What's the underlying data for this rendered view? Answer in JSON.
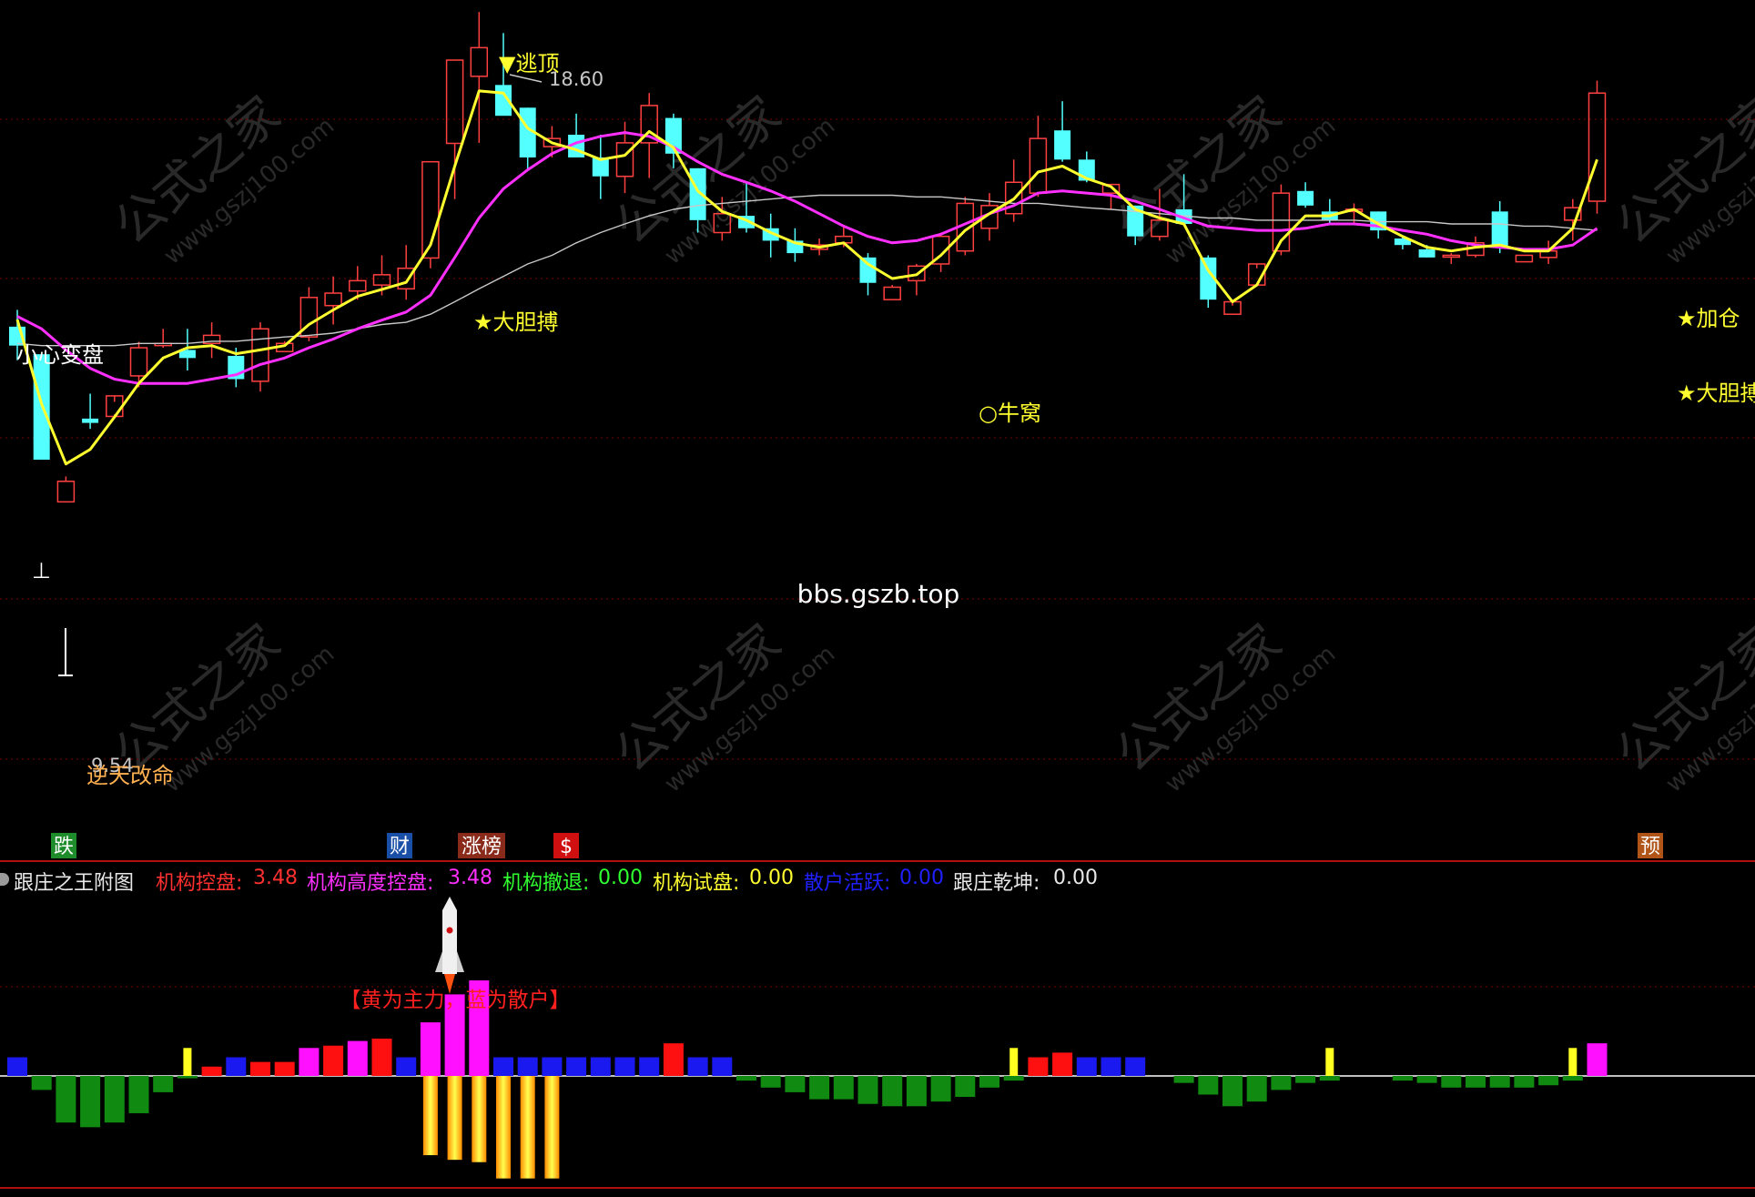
{
  "watermarks": {
    "site": "bbs.gszb.top",
    "brand": "公式之家",
    "brand_url": "www.gszj100.com"
  },
  "main_chart": {
    "annotations": {
      "escape_top": "逃顶",
      "high_value": "18.60",
      "bold_1": "大胆搏",
      "careful": "小心变盘",
      "bull_nest": "牛窝",
      "add_pos": "加仓",
      "bold_2": "大胆搏",
      "low_value": "9.54",
      "reverse": "逆天改命"
    },
    "event_badges": [
      {
        "text": "跌",
        "color": "#1e8c2a"
      },
      {
        "text": "财",
        "color": "#1a4fa8"
      },
      {
        "text": "涨榜",
        "color": "#8a2a1a"
      },
      {
        "text": "$",
        "color": "#d01010"
      },
      {
        "text": "预",
        "color": "#b05418"
      }
    ],
    "colors": {
      "up": "#ff4040",
      "down": "#54ffff",
      "ma_fast": "#ffff30",
      "ma_mid": "#ff30ff",
      "ma_slow": "#c8c8c8",
      "grid": "#7a0000"
    }
  },
  "info_bar": {
    "indicator_name": "跟庄之王附图",
    "items": [
      {
        "label": "机构控盘: ",
        "value": "3.48",
        "color": "#ff3030"
      },
      {
        "label": "机构高度控盘: ",
        "value": "3.48",
        "color": "#ff30ff"
      },
      {
        "label": "机构撤退: ",
        "value": "0.00",
        "color": "#30ff30"
      },
      {
        "label": "机构试盘: ",
        "value": "0.00",
        "color": "#ffff30"
      },
      {
        "label": "散户活跃: ",
        "value": "0.00",
        "color": "#2020ff"
      },
      {
        "label": "跟庄乾坤: ",
        "value": "0.00",
        "color": "#e8e8e8"
      }
    ],
    "note": "【黄为主力，蓝为散户】"
  },
  "chart_data": [
    {
      "type": "candlestick",
      "title": "",
      "price_labels": {
        "high": 18.6,
        "low": 9.54
      },
      "candles": [
        {
          "o": 12.78,
          "h": 13.09,
          "l": 12.16,
          "c": 12.43
        },
        {
          "o": 12.27,
          "h": 12.27,
          "l": 10.32,
          "c": 10.32
        },
        {
          "o": 9.54,
          "h": 10.01,
          "l": 9.54,
          "c": 9.92
        },
        {
          "o": 11.08,
          "h": 11.54,
          "l": 10.89,
          "c": 11.0
        },
        {
          "o": 11.12,
          "h": 11.39,
          "l": 11.16,
          "c": 11.5
        },
        {
          "o": 11.87,
          "h": 12.5,
          "l": 11.66,
          "c": 12.39
        },
        {
          "o": 12.43,
          "h": 12.74,
          "l": 12.39,
          "c": 12.47
        },
        {
          "o": 12.35,
          "h": 12.74,
          "l": 11.97,
          "c": 12.2
        },
        {
          "o": 12.47,
          "h": 12.86,
          "l": 12.2,
          "c": 12.62
        },
        {
          "o": 12.24,
          "h": 12.39,
          "l": 11.66,
          "c": 11.81
        },
        {
          "o": 11.77,
          "h": 12.86,
          "l": 11.58,
          "c": 12.74
        },
        {
          "o": 12.32,
          "h": 12.51,
          "l": 12.32,
          "c": 12.47
        },
        {
          "o": 12.59,
          "h": 13.51,
          "l": 12.51,
          "c": 13.32
        },
        {
          "o": 13.17,
          "h": 13.71,
          "l": 12.82,
          "c": 13.4
        },
        {
          "o": 13.44,
          "h": 13.9,
          "l": 13.28,
          "c": 13.63
        },
        {
          "o": 13.55,
          "h": 14.1,
          "l": 13.36,
          "c": 13.74
        },
        {
          "o": 13.48,
          "h": 14.29,
          "l": 13.28,
          "c": 13.86
        },
        {
          "o": 14.05,
          "h": 15.83,
          "l": 13.86,
          "c": 15.83
        },
        {
          "o": 16.17,
          "h": 17.71,
          "l": 15.14,
          "c": 17.71
        },
        {
          "o": 17.41,
          "h": 18.6,
          "l": 16.18,
          "c": 17.94
        },
        {
          "o": 17.25,
          "h": 18.21,
          "l": 16.87,
          "c": 16.68
        },
        {
          "o": 16.83,
          "h": 16.83,
          "l": 15.68,
          "c": 15.91
        },
        {
          "o": 16.11,
          "h": 16.49,
          "l": 15.91,
          "c": 16.26
        },
        {
          "o": 16.33,
          "h": 16.72,
          "l": 16.1,
          "c": 15.91
        },
        {
          "o": 15.91,
          "h": 16.33,
          "l": 15.14,
          "c": 15.56
        },
        {
          "o": 15.56,
          "h": 16.57,
          "l": 15.25,
          "c": 16.18
        },
        {
          "o": 16.18,
          "h": 17.1,
          "l": 15.53,
          "c": 16.87
        },
        {
          "o": 16.64,
          "h": 16.72,
          "l": 15.71,
          "c": 15.98
        },
        {
          "o": 15.71,
          "h": 15.71,
          "l": 14.52,
          "c": 14.75
        },
        {
          "o": 14.52,
          "h": 15.18,
          "l": 14.37,
          "c": 14.87
        },
        {
          "o": 14.83,
          "h": 15.45,
          "l": 14.52,
          "c": 14.6
        },
        {
          "o": 14.6,
          "h": 14.87,
          "l": 14.06,
          "c": 14.37
        },
        {
          "o": 14.37,
          "h": 14.6,
          "l": 13.98,
          "c": 14.14
        },
        {
          "o": 14.21,
          "h": 14.41,
          "l": 14.1,
          "c": 14.29
        },
        {
          "o": 14.33,
          "h": 14.64,
          "l": 14.25,
          "c": 14.45
        },
        {
          "o": 14.06,
          "h": 14.14,
          "l": 13.36,
          "c": 13.59
        },
        {
          "o": 13.28,
          "h": 13.55,
          "l": 13.28,
          "c": 13.51
        },
        {
          "o": 13.63,
          "h": 13.94,
          "l": 13.36,
          "c": 13.9
        },
        {
          "o": 13.94,
          "h": 14.52,
          "l": 13.79,
          "c": 14.45
        },
        {
          "o": 14.18,
          "h": 15.18,
          "l": 14.1,
          "c": 15.06
        },
        {
          "o": 14.6,
          "h": 15.25,
          "l": 14.37,
          "c": 15.02
        },
        {
          "o": 14.87,
          "h": 15.87,
          "l": 14.72,
          "c": 15.45
        },
        {
          "o": 15.25,
          "h": 16.68,
          "l": 15.18,
          "c": 16.26
        },
        {
          "o": 16.41,
          "h": 16.95,
          "l": 15.83,
          "c": 15.87
        },
        {
          "o": 15.87,
          "h": 16.02,
          "l": 15.45,
          "c": 15.48
        },
        {
          "o": 15.25,
          "h": 15.41,
          "l": 14.95,
          "c": 15.41
        },
        {
          "o": 15.02,
          "h": 15.02,
          "l": 14.29,
          "c": 14.45
        },
        {
          "o": 14.45,
          "h": 15.33,
          "l": 14.37,
          "c": 14.75
        },
        {
          "o": 14.95,
          "h": 15.6,
          "l": 14.68,
          "c": 14.68
        },
        {
          "o": 14.06,
          "h": 14.1,
          "l": 13.13,
          "c": 13.28
        },
        {
          "o": 13.01,
          "h": 13.17,
          "l": 13.01,
          "c": 13.24
        },
        {
          "o": 13.55,
          "h": 13.86,
          "l": 13.55,
          "c": 13.94
        },
        {
          "o": 14.18,
          "h": 15.41,
          "l": 14.1,
          "c": 15.25
        },
        {
          "o": 15.29,
          "h": 15.45,
          "l": 14.98,
          "c": 15.02
        },
        {
          "o": 14.91,
          "h": 15.14,
          "l": 14.68,
          "c": 14.75
        },
        {
          "o": 14.91,
          "h": 15.06,
          "l": 14.68,
          "c": 14.95
        },
        {
          "o": 14.91,
          "h": 14.91,
          "l": 14.41,
          "c": 14.56
        },
        {
          "o": 14.41,
          "h": 14.45,
          "l": 14.21,
          "c": 14.29
        },
        {
          "o": 14.21,
          "h": 14.29,
          "l": 14.06,
          "c": 14.06
        },
        {
          "o": 14.1,
          "h": 14.14,
          "l": 13.94,
          "c": 14.1
        },
        {
          "o": 14.1,
          "h": 14.45,
          "l": 14.06,
          "c": 14.33
        },
        {
          "o": 14.91,
          "h": 15.1,
          "l": 14.14,
          "c": 14.25
        },
        {
          "o": 13.98,
          "h": 14.1,
          "l": 13.98,
          "c": 14.1
        },
        {
          "o": 14.06,
          "h": 14.37,
          "l": 13.94,
          "c": 14.18
        },
        {
          "o": 14.75,
          "h": 15.14,
          "l": 14.37,
          "c": 14.98
        },
        {
          "o": 15.1,
          "h": 17.33,
          "l": 14.87,
          "c": 17.1
        }
      ],
      "ma_fast": [
        12.91,
        11.35,
        10.24,
        10.51,
        11.11,
        11.73,
        12.2,
        12.39,
        12.43,
        12.28,
        12.35,
        12.43,
        12.82,
        13.09,
        13.34,
        13.47,
        13.6,
        14.29,
        15.75,
        17.14,
        17.1,
        16.45,
        16.18,
        16.05,
        15.87,
        15.95,
        16.39,
        16.09,
        15.29,
        14.91,
        14.75,
        14.52,
        14.33,
        14.25,
        14.33,
        13.94,
        13.67,
        13.74,
        14.1,
        14.56,
        14.87,
        15.14,
        15.64,
        15.75,
        15.52,
        15.37,
        14.95,
        14.79,
        14.68,
        13.82,
        13.24,
        13.55,
        14.37,
        14.83,
        14.83,
        14.95,
        14.68,
        14.45,
        14.25,
        14.18,
        14.25,
        14.29,
        14.18,
        14.18,
        14.6,
        15.87
      ],
      "ma_mid": [
        12.97,
        12.74,
        12.35,
        12.01,
        11.81,
        11.73,
        11.73,
        11.73,
        11.81,
        11.89,
        12.08,
        12.2,
        12.39,
        12.55,
        12.74,
        12.9,
        13.05,
        13.36,
        14.06,
        14.79,
        15.33,
        15.68,
        15.98,
        16.18,
        16.3,
        16.37,
        16.3,
        16.1,
        15.83,
        15.6,
        15.45,
        15.29,
        15.1,
        14.87,
        14.64,
        14.45,
        14.33,
        14.37,
        14.49,
        14.68,
        14.87,
        15.02,
        15.25,
        15.29,
        15.25,
        15.21,
        15.1,
        14.95,
        14.79,
        14.64,
        14.6,
        14.56,
        14.56,
        14.6,
        14.68,
        14.68,
        14.64,
        14.56,
        14.49,
        14.37,
        14.29,
        14.25,
        14.21,
        14.21,
        14.29,
        14.6
      ],
      "ma_slow": [
        12.47,
        12.43,
        12.43,
        12.43,
        12.43,
        12.47,
        12.47,
        12.47,
        12.51,
        12.51,
        12.55,
        12.59,
        12.62,
        12.66,
        12.74,
        12.82,
        12.86,
        13.01,
        13.24,
        13.48,
        13.71,
        13.94,
        14.1,
        14.33,
        14.52,
        14.68,
        14.83,
        14.95,
        15.02,
        15.06,
        15.1,
        15.14,
        15.18,
        15.21,
        15.21,
        15.21,
        15.21,
        15.18,
        15.18,
        15.14,
        15.1,
        15.06,
        15.06,
        15.02,
        14.98,
        14.95,
        14.91,
        14.87,
        14.83,
        14.79,
        14.79,
        14.75,
        14.75,
        14.75,
        14.75,
        14.75,
        14.72,
        14.72,
        14.72,
        14.68,
        14.68,
        14.68,
        14.64,
        14.64,
        14.6,
        14.56
      ]
    },
    {
      "type": "bar",
      "title": "跟庄之王附图",
      "baseline": 0,
      "positive": [
        {
          "i": 0,
          "v": 0.8,
          "c": "blue"
        },
        {
          "i": 7,
          "v": 1.2,
          "c": "yellow"
        },
        {
          "i": 8,
          "v": 0.4,
          "c": "red"
        },
        {
          "i": 9,
          "v": 0.8,
          "c": "blue"
        },
        {
          "i": 10,
          "v": 0.6,
          "c": "red"
        },
        {
          "i": 11,
          "v": 0.6,
          "c": "red"
        },
        {
          "i": 12,
          "v": 1.2,
          "c": "magenta"
        },
        {
          "i": 13,
          "v": 1.3,
          "c": "red"
        },
        {
          "i": 14,
          "v": 1.5,
          "c": "magenta"
        },
        {
          "i": 15,
          "v": 1.6,
          "c": "red"
        },
        {
          "i": 16,
          "v": 0.8,
          "c": "blue"
        },
        {
          "i": 17,
          "v": 2.3,
          "c": "magenta"
        },
        {
          "i": 18,
          "v": 3.5,
          "c": "magenta"
        },
        {
          "i": 19,
          "v": 4.1,
          "c": "magenta"
        },
        {
          "i": 20,
          "v": 0.8,
          "c": "blue"
        },
        {
          "i": 21,
          "v": 0.8,
          "c": "blue"
        },
        {
          "i": 22,
          "v": 0.8,
          "c": "blue"
        },
        {
          "i": 23,
          "v": 0.8,
          "c": "blue"
        },
        {
          "i": 24,
          "v": 0.8,
          "c": "blue"
        },
        {
          "i": 25,
          "v": 0.8,
          "c": "blue"
        },
        {
          "i": 26,
          "v": 0.8,
          "c": "blue"
        },
        {
          "i": 27,
          "v": 1.4,
          "c": "red"
        },
        {
          "i": 28,
          "v": 0.8,
          "c": "blue"
        },
        {
          "i": 29,
          "v": 0.8,
          "c": "blue"
        },
        {
          "i": 41,
          "v": 1.2,
          "c": "yellow"
        },
        {
          "i": 42,
          "v": 0.8,
          "c": "red"
        },
        {
          "i": 43,
          "v": 1.0,
          "c": "red"
        },
        {
          "i": 44,
          "v": 0.8,
          "c": "blue"
        },
        {
          "i": 45,
          "v": 0.8,
          "c": "blue"
        },
        {
          "i": 46,
          "v": 0.8,
          "c": "blue"
        },
        {
          "i": 54,
          "v": 1.2,
          "c": "yellow"
        },
        {
          "i": 64,
          "v": 1.2,
          "c": "yellow"
        },
        {
          "i": 65,
          "v": 1.4,
          "c": "magenta"
        }
      ],
      "negative": [
        {
          "i": 1,
          "v": -0.6,
          "c": "green"
        },
        {
          "i": 2,
          "v": -2.0,
          "c": "green"
        },
        {
          "i": 3,
          "v": -2.2,
          "c": "green"
        },
        {
          "i": 4,
          "v": -2.0,
          "c": "green"
        },
        {
          "i": 5,
          "v": -1.6,
          "c": "green"
        },
        {
          "i": 6,
          "v": -0.7,
          "c": "green"
        },
        {
          "i": 7,
          "v": -0.1,
          "c": "green"
        },
        {
          "i": 17,
          "v": -3.4,
          "c": "gold"
        },
        {
          "i": 18,
          "v": -3.6,
          "c": "gold"
        },
        {
          "i": 19,
          "v": -3.7,
          "c": "gold"
        },
        {
          "i": 20,
          "v": -4.4,
          "c": "gold"
        },
        {
          "i": 21,
          "v": -4.4,
          "c": "gold"
        },
        {
          "i": 22,
          "v": -4.4,
          "c": "gold"
        },
        {
          "i": 30,
          "v": -0.2,
          "c": "green"
        },
        {
          "i": 31,
          "v": -0.5,
          "c": "green"
        },
        {
          "i": 32,
          "v": -0.7,
          "c": "green"
        },
        {
          "i": 33,
          "v": -1.0,
          "c": "green"
        },
        {
          "i": 34,
          "v": -1.0,
          "c": "green"
        },
        {
          "i": 35,
          "v": -1.2,
          "c": "green"
        },
        {
          "i": 36,
          "v": -1.3,
          "c": "green"
        },
        {
          "i": 37,
          "v": -1.3,
          "c": "green"
        },
        {
          "i": 38,
          "v": -1.1,
          "c": "green"
        },
        {
          "i": 39,
          "v": -0.9,
          "c": "green"
        },
        {
          "i": 40,
          "v": -0.5,
          "c": "green"
        },
        {
          "i": 41,
          "v": -0.2,
          "c": "green"
        },
        {
          "i": 48,
          "v": -0.3,
          "c": "green"
        },
        {
          "i": 49,
          "v": -0.8,
          "c": "green"
        },
        {
          "i": 50,
          "v": -1.3,
          "c": "green"
        },
        {
          "i": 51,
          "v": -1.1,
          "c": "green"
        },
        {
          "i": 52,
          "v": -0.6,
          "c": "green"
        },
        {
          "i": 53,
          "v": -0.3,
          "c": "green"
        },
        {
          "i": 54,
          "v": -0.2,
          "c": "green"
        },
        {
          "i": 57,
          "v": -0.2,
          "c": "green"
        },
        {
          "i": 58,
          "v": -0.3,
          "c": "green"
        },
        {
          "i": 59,
          "v": -0.5,
          "c": "green"
        },
        {
          "i": 60,
          "v": -0.5,
          "c": "green"
        },
        {
          "i": 61,
          "v": -0.5,
          "c": "green"
        },
        {
          "i": 62,
          "v": -0.5,
          "c": "green"
        },
        {
          "i": 63,
          "v": -0.4,
          "c": "green"
        },
        {
          "i": 64,
          "v": -0.2,
          "c": "green"
        }
      ]
    }
  ]
}
